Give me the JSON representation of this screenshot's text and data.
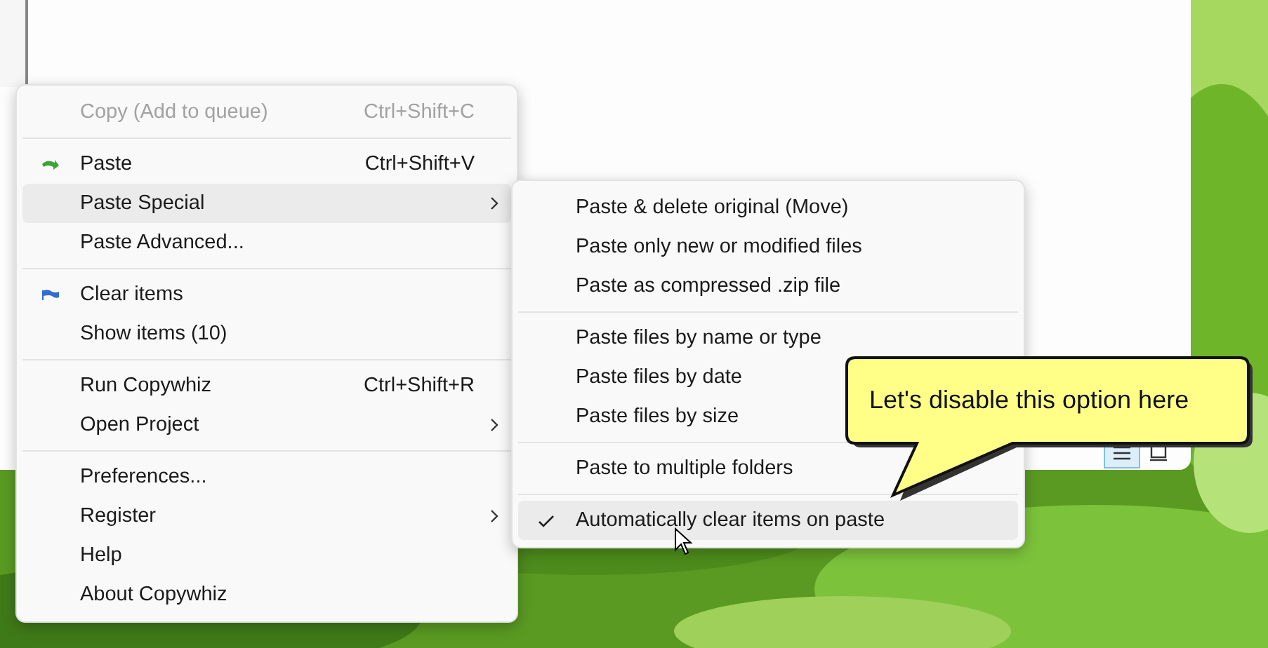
{
  "menu": {
    "items": [
      {
        "kind": "item",
        "label": "Copy (Add to queue)",
        "shortcut": "Ctrl+Shift+C",
        "disabled": true,
        "selected": false
      },
      {
        "kind": "separator"
      },
      {
        "kind": "paste",
        "label": "Paste",
        "shortcut": "Ctrl+Shift+V",
        "disabled": false,
        "selected": false
      },
      {
        "kind": "item",
        "label": "Paste Special",
        "submenu": true,
        "disabled": false,
        "selected": true
      },
      {
        "kind": "item",
        "label": "Paste Advanced...",
        "disabled": false,
        "selected": false
      },
      {
        "kind": "separator"
      },
      {
        "kind": "flag",
        "label": "Clear items",
        "disabled": false,
        "selected": false
      },
      {
        "kind": "item",
        "label": "Show items (10)",
        "disabled": false,
        "selected": false
      },
      {
        "kind": "separator"
      },
      {
        "kind": "item",
        "label": "Run Copywhiz",
        "shortcut": "Ctrl+Shift+R",
        "disabled": false,
        "selected": false
      },
      {
        "kind": "item",
        "label": "Open Project",
        "submenu": true,
        "disabled": false,
        "selected": false
      },
      {
        "kind": "separator"
      },
      {
        "kind": "item",
        "label": "Preferences...",
        "disabled": false,
        "selected": false
      },
      {
        "kind": "item",
        "label": "Register",
        "submenu": true,
        "disabled": false,
        "selected": false
      },
      {
        "kind": "item",
        "label": "Help",
        "disabled": false,
        "selected": false
      },
      {
        "kind": "item",
        "label": "About Copywhiz",
        "disabled": false,
        "selected": false
      }
    ]
  },
  "submenu": {
    "items": [
      {
        "kind": "item",
        "label": "Paste & delete original (Move)",
        "checked": false,
        "selected": false
      },
      {
        "kind": "item",
        "label": "Paste only new or modified files",
        "checked": false,
        "selected": false
      },
      {
        "kind": "item",
        "label": "Paste as compressed .zip file",
        "checked": false,
        "selected": false
      },
      {
        "kind": "separator"
      },
      {
        "kind": "item",
        "label": "Paste files by name or type",
        "checked": false,
        "selected": false
      },
      {
        "kind": "item",
        "label": "Paste files by date",
        "checked": false,
        "selected": false
      },
      {
        "kind": "item",
        "label": "Paste files by size",
        "checked": false,
        "selected": false
      },
      {
        "kind": "separator"
      },
      {
        "kind": "item",
        "label": "Paste to multiple folders",
        "checked": false,
        "selected": false
      },
      {
        "kind": "separator"
      },
      {
        "kind": "item",
        "label": "Automatically clear items on paste",
        "checked": true,
        "selected": true
      }
    ]
  },
  "view_buttons": [
    {
      "kind": "list",
      "selected": true
    },
    {
      "kind": "tiles",
      "selected": false
    }
  ],
  "callout": {
    "text": "Let's disable this option here"
  }
}
